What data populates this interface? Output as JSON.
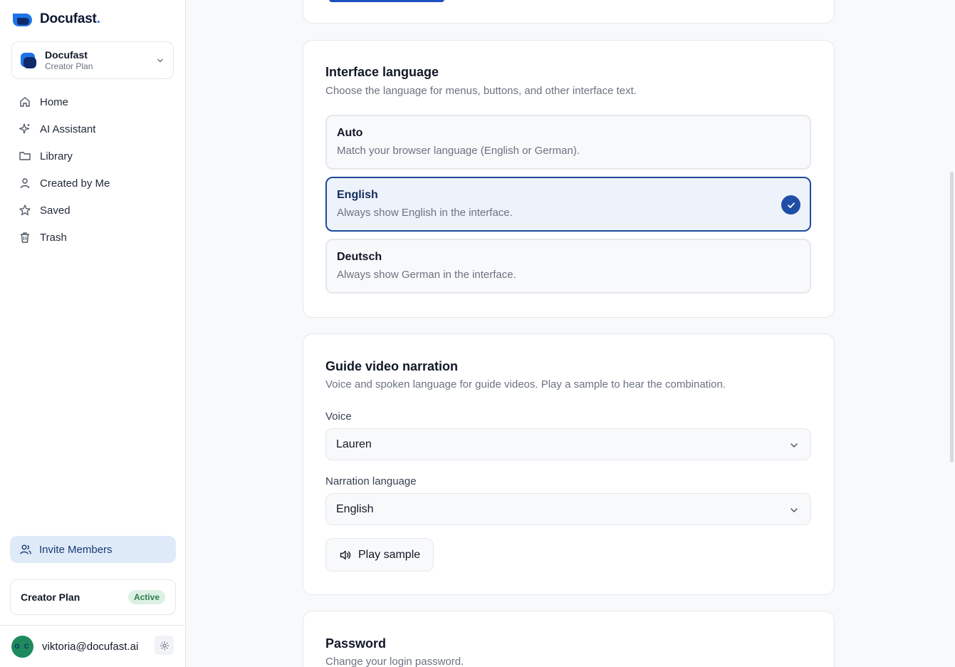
{
  "brand": {
    "name": "Docufast",
    "dot": "."
  },
  "workspace": {
    "name": "Docufast",
    "plan": "Creator Plan"
  },
  "nav": [
    {
      "label": "Home",
      "icon": "home-icon"
    },
    {
      "label": "AI Assistant",
      "icon": "sparkle-icon"
    },
    {
      "label": "Library",
      "icon": "folder-icon"
    },
    {
      "label": "Created by Me",
      "icon": "user-icon"
    },
    {
      "label": "Saved",
      "icon": "star-icon"
    },
    {
      "label": "Trash",
      "icon": "trash-icon"
    }
  ],
  "invite": {
    "label": "Invite Members"
  },
  "plan": {
    "name": "Creator Plan",
    "status": "Active"
  },
  "user": {
    "initials": "O C",
    "email": "viktoria@docufast.ai"
  },
  "interface_language": {
    "title": "Interface language",
    "description": "Choose the language for menus, buttons, and other interface text.",
    "options": [
      {
        "title": "Auto",
        "description": "Match your browser language (English or German).",
        "selected": false
      },
      {
        "title": "English",
        "description": "Always show English in the interface.",
        "selected": true
      },
      {
        "title": "Deutsch",
        "description": "Always show German in the interface.",
        "selected": false
      }
    ]
  },
  "narration": {
    "title": "Guide video narration",
    "description": "Voice and spoken language for guide videos. Play a sample to hear the combination.",
    "voice_label": "Voice",
    "voice_value": "Lauren",
    "language_label": "Narration language",
    "language_value": "English",
    "play_label": "Play sample"
  },
  "password": {
    "title": "Password",
    "description": "Change your login password."
  },
  "colors": {
    "accent": "#1f4ea6",
    "invite_bg": "#dfeaf9",
    "active_badge": "#dcf1e3"
  }
}
